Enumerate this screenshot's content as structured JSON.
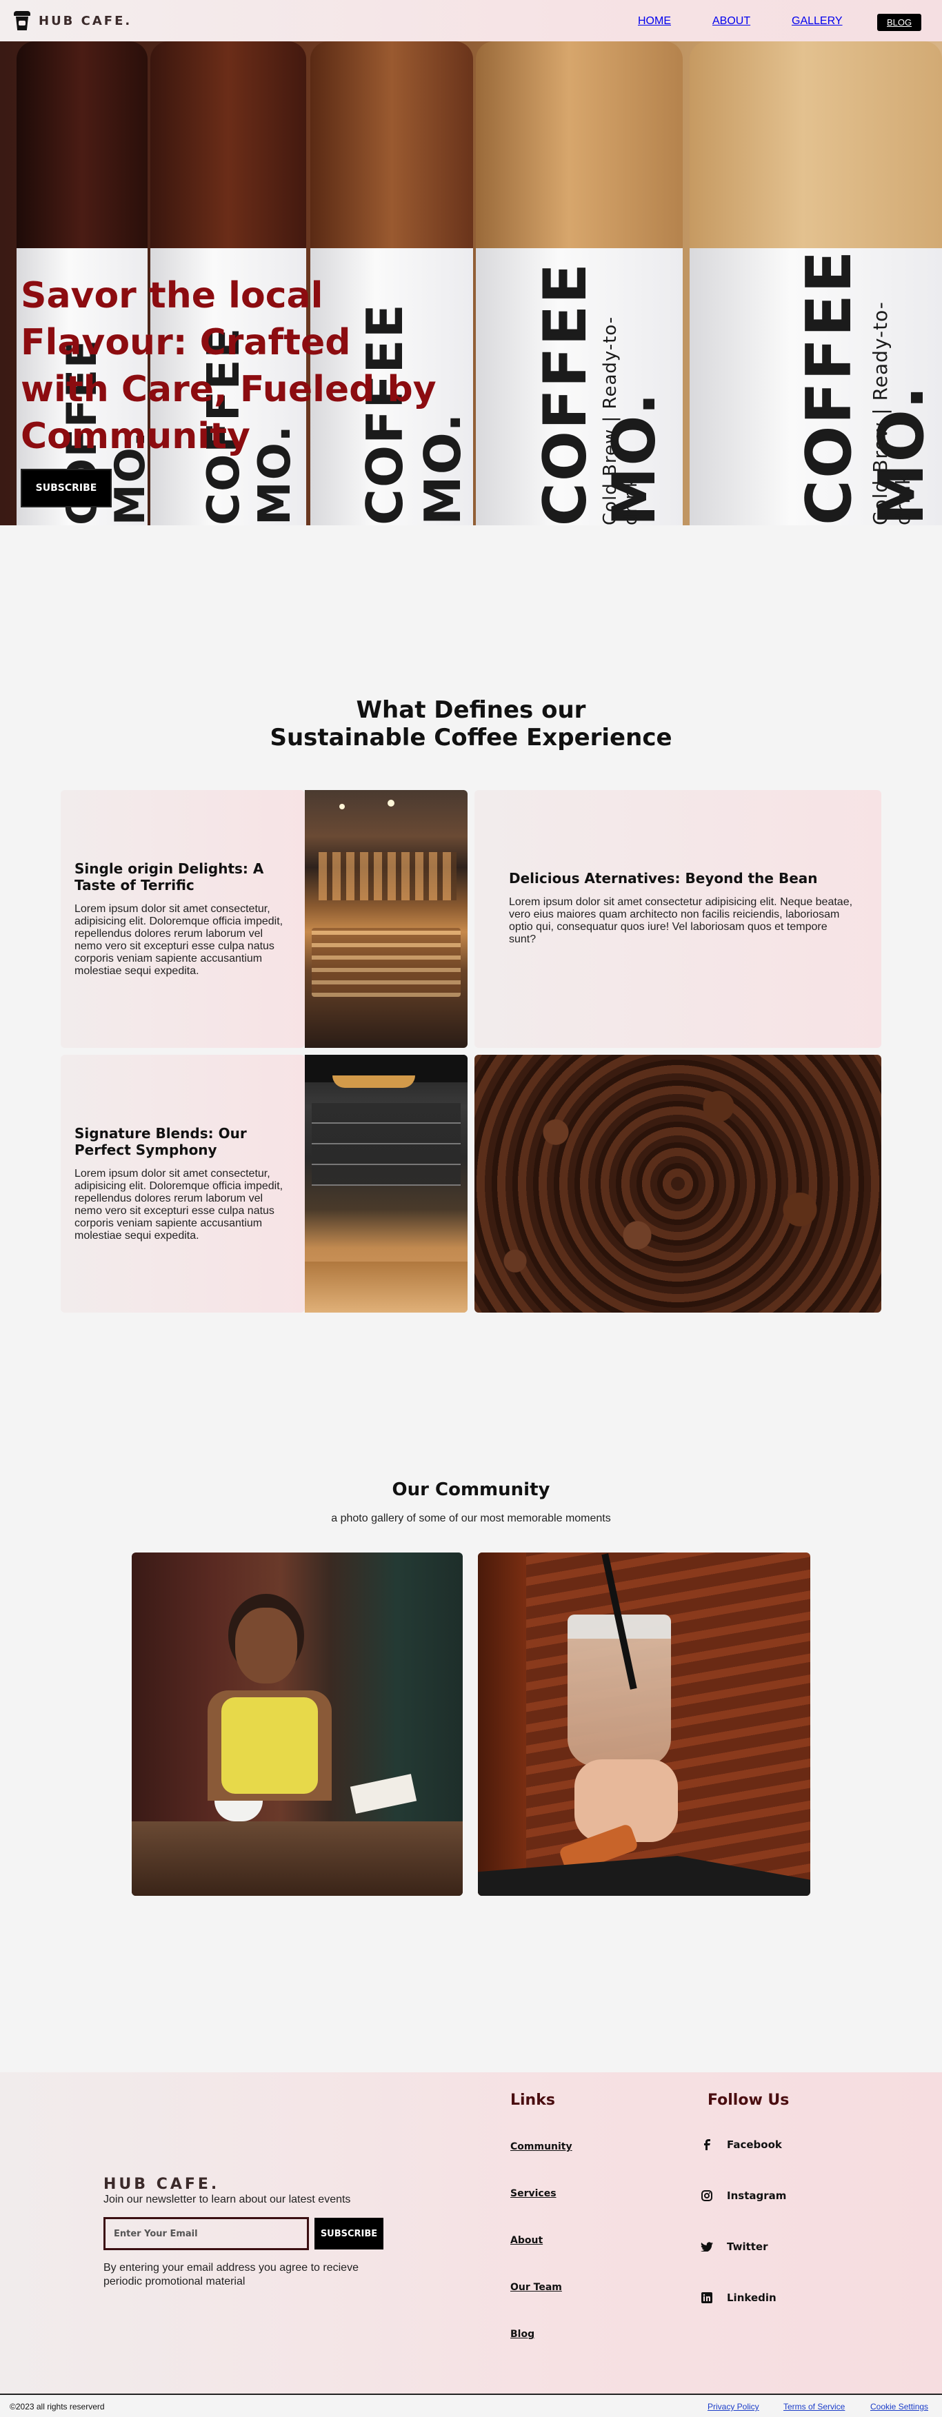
{
  "nav": {
    "brand": "HUB CAFE.",
    "links": [
      "HOME",
      "ABOUT",
      "GALLERY"
    ],
    "blog": "BLOG"
  },
  "hero": {
    "title": "Savor the local Flavour: Crafted with Care, Fueled by Community",
    "button": "SUBSCRIBE",
    "bottle_text": "COFFEE MO.",
    "bottle_subtext": "Cold Brew | Ready-to-drink"
  },
  "features": {
    "title_line1": "What Defines our",
    "title_line2": "Sustainable Coffee Experience",
    "cards": [
      {
        "title": "Single origin Delights: A Taste of Terrific",
        "text": "Lorem ipsum dolor sit amet consectetur, adipisicing elit. Doloremque officia impedit, repellendus dolores rerum laborum vel nemo vero sit excepturi esse culpa natus corporis veniam sapiente accusantium molestiae sequi expedita."
      },
      {
        "title": "Delicious Aternatives: Beyond the Bean",
        "text": "Lorem ipsum dolor sit amet consectetur adipisicing elit. Neque beatae, vero eius maiores quam architecto non facilis reiciendis, laboriosam optio qui, consequatur quos iure! Vel laboriosam quos et tempore sunt?"
      },
      {
        "title": "Signature Blends: Our Perfect Symphony",
        "text": "Lorem ipsum dolor sit amet consectetur, adipisicing elit. Doloremque officia impedit, repellendus dolores rerum laborum vel nemo vero sit excepturi esse culpa natus corporis veniam sapiente accusantium molestiae sequi expedita."
      }
    ]
  },
  "community": {
    "title": "Our Community",
    "subtitle": "a photo gallery of some of our most memorable moments"
  },
  "footer": {
    "brand": "HUB CAFE.",
    "join": "Join our newsletter to learn about our latest events",
    "email_placeholder": "Enter Your Email",
    "subscribe": "SUBSCRIBE",
    "note": "By entering your email address you agree to recieve periodic promotional material",
    "links_title": "Links",
    "links": [
      "Community",
      "Services",
      "About",
      "Our Team",
      "Blog"
    ],
    "follow_title": "Follow Us",
    "social": [
      {
        "label": "Facebook",
        "icon": "facebook-icon"
      },
      {
        "label": "Instagram",
        "icon": "instagram-icon"
      },
      {
        "label": "Twitter",
        "icon": "twitter-icon"
      },
      {
        "label": "Linkedin",
        "icon": "linkedin-icon"
      }
    ],
    "copyright": "©2023 all rights reserverd",
    "legal": [
      "Privacy Policy",
      "Terms of Service",
      "Cookie Settings"
    ]
  }
}
